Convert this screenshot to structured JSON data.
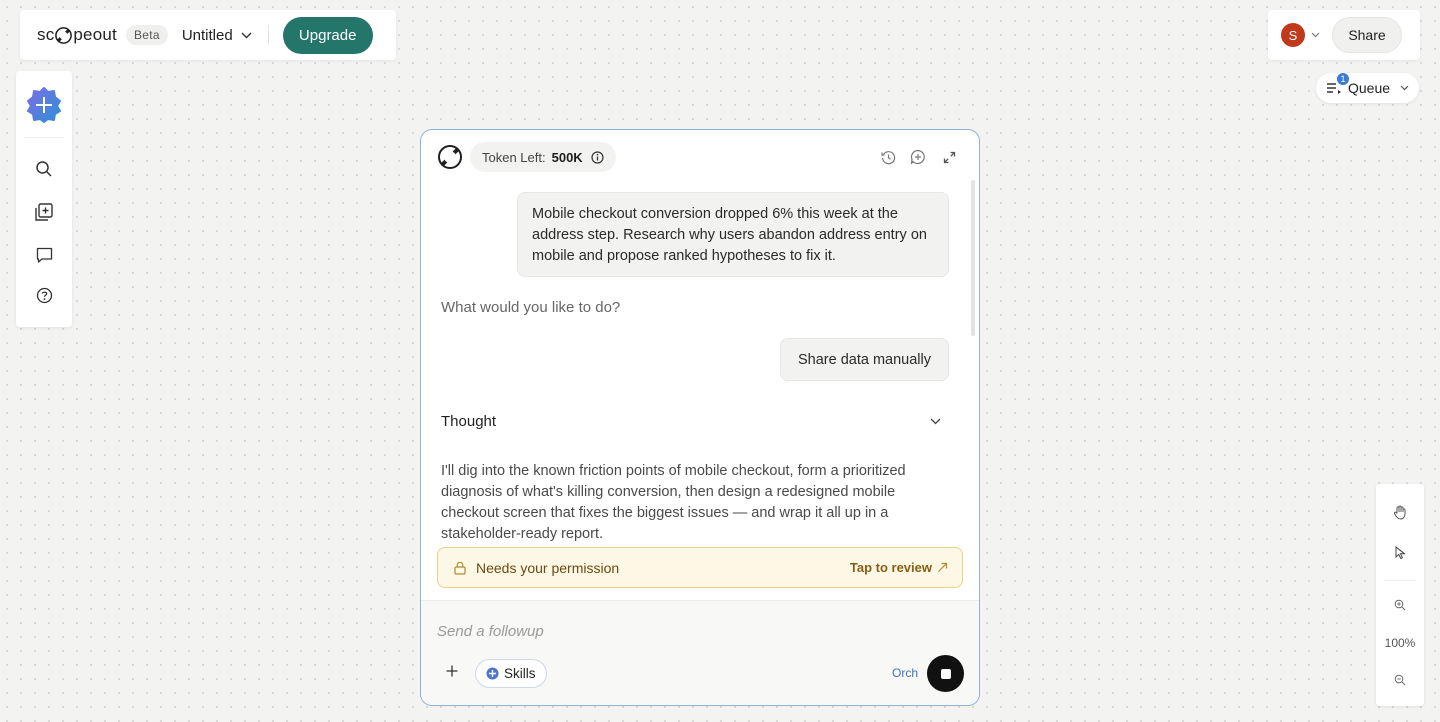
{
  "app": {
    "logo_text_left": "sc",
    "logo_text_right": "peout",
    "beta": "Beta",
    "doc_title": "Untitled",
    "upgrade": "Upgrade"
  },
  "user": {
    "avatar_initial": "S",
    "share": "Share"
  },
  "queue": {
    "label": "Queue",
    "count": "1"
  },
  "sidebar": {
    "items": [
      "new-project",
      "search",
      "add-page",
      "comments",
      "help"
    ]
  },
  "panel": {
    "token_label": "Token Left:",
    "token_value": "500K",
    "user_message": "Mobile checkout conversion dropped 6% this week at the address step. Research why users abandon address entry on mobile and propose ranked hypotheses to fix it.",
    "assistant_question": "What would you like to do?",
    "user_reply": "Share data manually",
    "thought_label": "Thought",
    "thought_text": "I'll dig into the known friction points of mobile checkout, form a prioritized diagnosis of what's killing conversion, then design a redesigned mobile checkout screen that fixes the biggest issues — and wrap it all up in a stakeholder-ready report.",
    "permission_text": "Needs your permission",
    "permission_action": "Tap to review"
  },
  "composer": {
    "placeholder": "Send a followup",
    "skills": "Skills",
    "mode": "Orch"
  },
  "toolrail": {
    "zoom": "100%"
  },
  "colors": {
    "accent": "#24756a",
    "panel_border": "#8fb1d8",
    "avatar": "#c0391b",
    "permission_bg": "#fdf8e6"
  }
}
